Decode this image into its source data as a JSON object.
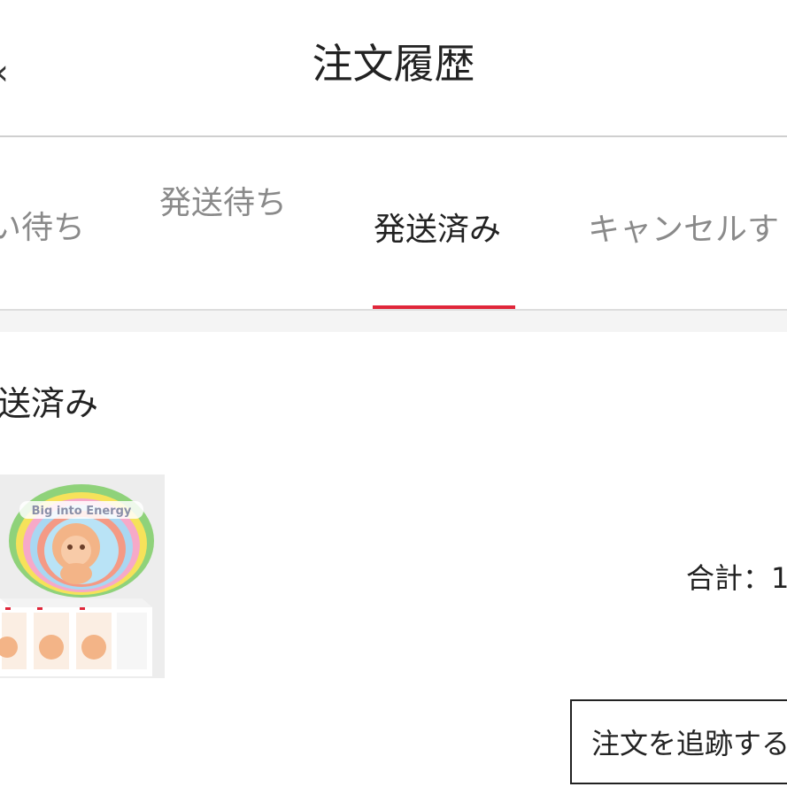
{
  "header": {
    "back_icon": "chevron-left-icon",
    "title": "注文履歴"
  },
  "tabs": [
    {
      "label": "い待ち"
    },
    {
      "label": "発送待ち"
    },
    {
      "label": "発送済み",
      "active": true
    },
    {
      "label": "キャンセルす"
    }
  ],
  "accent_color": "#e0263a",
  "order": {
    "status": "送済み",
    "product_image": {
      "box_text": "Big into Energy"
    },
    "total_label": "合計：1",
    "track_button": "注文を追跡する"
  }
}
